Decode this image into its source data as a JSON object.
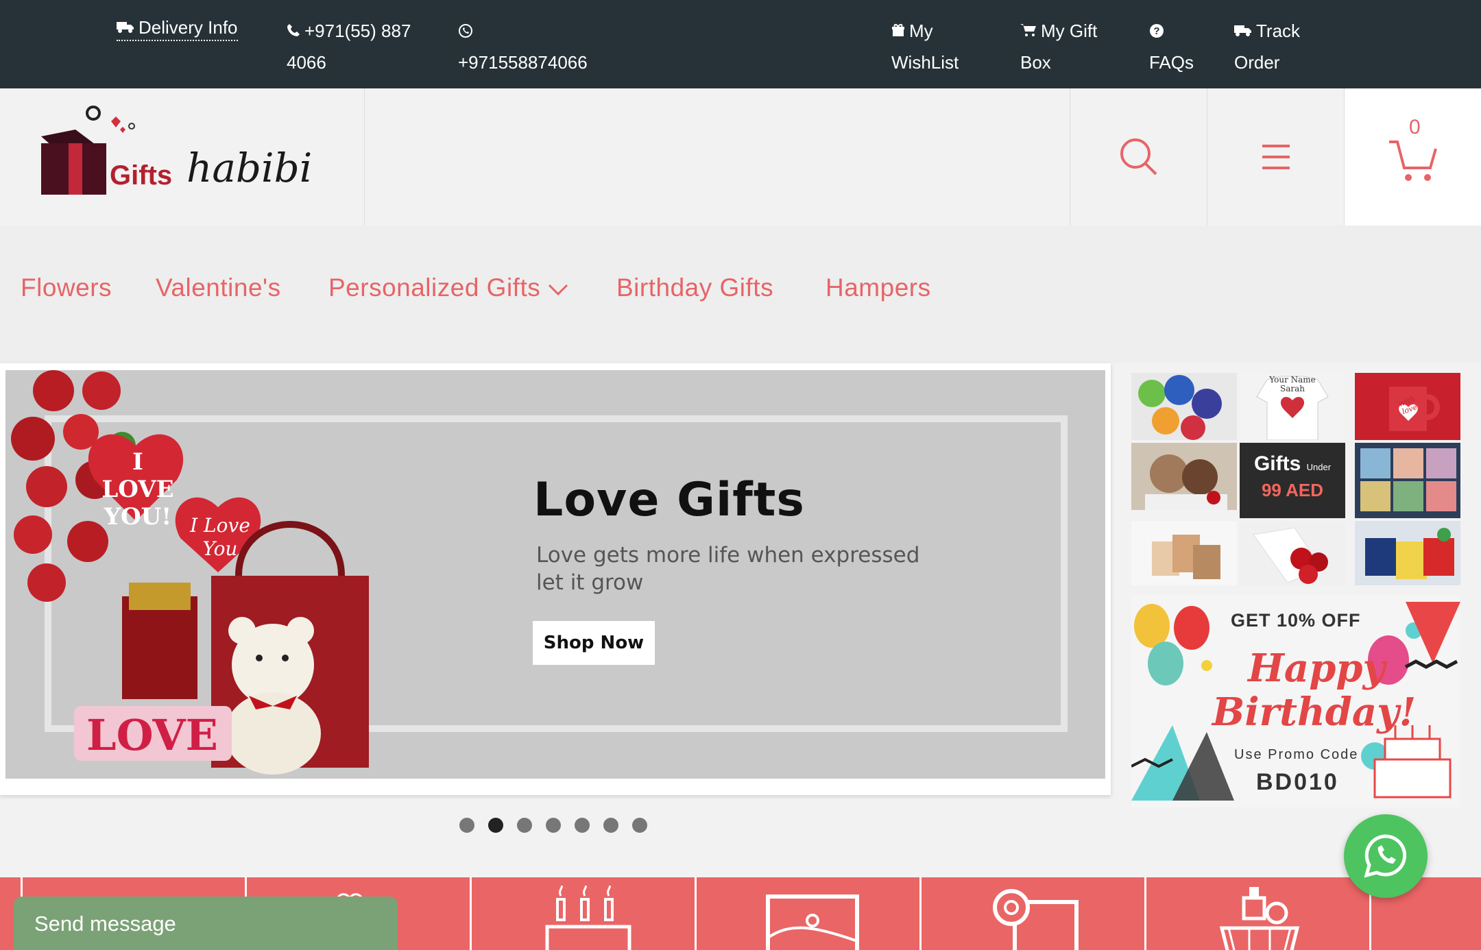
{
  "topbar": {
    "delivery_info": "Delivery Info",
    "phone": "+971(55) 887 4066",
    "whatsapp": "+971558874066",
    "wishlist": "My WishList",
    "giftbox": "My Gift Box",
    "faqs": "FAQs",
    "track": "Track Order"
  },
  "header": {
    "logo_gifts": "Gifts",
    "logo_habibi": "habibi",
    "cart_count": "0"
  },
  "nav": {
    "items": [
      "Flowers",
      "Valentine's",
      "Personalized Gifts",
      "Birthday Gifts",
      "Hampers"
    ]
  },
  "slider": {
    "title": "Love Gifts",
    "subtitle": "Love gets more life when expressed let it grow",
    "button": "Shop Now",
    "slide_count": 7,
    "active_index": 1,
    "balloon1": "I LOVE YOU!",
    "balloon2": "I Love You",
    "love_text": "LOVE"
  },
  "promo": {
    "gifts_label": "Gifts",
    "under_label": "Under",
    "price_label": "99 AED",
    "tshirt_text": "Your Name Sarah",
    "mug_text": "with love"
  },
  "birthday": {
    "offer": "GET 10% OFF",
    "happy": "Happy",
    "birthday": "Birthday!",
    "promo_label": "Use Promo Code",
    "promo_code": "BD010"
  },
  "chat": {
    "send_message": "Send message"
  },
  "colors": {
    "topbar_bg": "#263238",
    "accent": "#e76466",
    "category_strip": "#ea6565",
    "whatsapp": "#4dc460",
    "chat_bg": "#7ba276"
  }
}
